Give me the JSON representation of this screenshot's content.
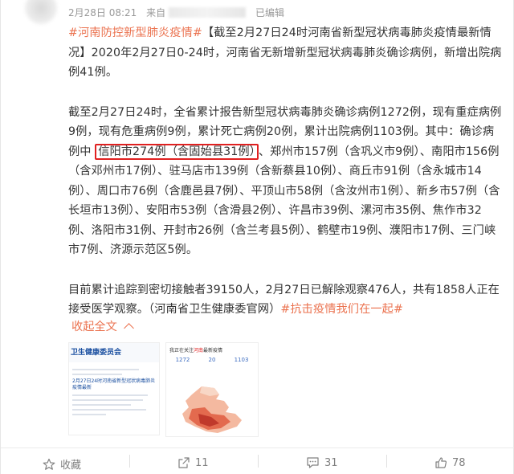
{
  "post": {
    "date": "2月28日 08:21",
    "source_prefix": "来自",
    "edited": "已编辑",
    "hashtag_main": "#河南防控新型肺炎疫情#",
    "para1_rest": "【截至2月27日24时河南省新型冠状病毒肺炎疫情最新情况】2020年2月27日0-24时，河南省无新增新型冠状病毒肺炎确诊病例，新增出院病例41例。",
    "para2_a": "截至2月27日24时，全省累计报告新型冠状病毒肺炎确诊病例1272例，现有重症病例9例，现有危重病例9例，累计死亡病例20例，累计出院病例1103例。其中：确诊病例中 ",
    "para2_highlight": "信阳市274例（含固始县31例）",
    "para2_b": "、郑州市157例（含巩义市9例）、南阳市156例（含邓州市17例）、驻马店市139例（含新蔡县10例）、商丘市91例（含永城市14例）、周口市76例（含鹿邑县7例）、平顶山市58例（含汝州市1例）、新乡市57例（含长垣市13例）、安阳市53例（含滑县2例）、许昌市39例、漯河市35例、焦作市32例、洛阳市31例、开封市26例（含兰考县5例）、鹤壁市19例、濮阳市17例、三门峡市7例、济源示范区5例。",
    "para3_a": "目前累计追踪到密切接触者39150人，2月27日已解除观察476人，共有1858人正在接受医学观察。（河南省卫生健康委官网）",
    "hashtag_end": "#抗击疫情我们在一起#",
    "collapse_label": "收起全文"
  },
  "images": {
    "img1": {
      "logo_text": "卫生健康委员会",
      "headline": "2月27日24时河南省新型冠状病毒肺炎疫情最新"
    },
    "img2": {
      "title_prefix": "我正在关注",
      "title_region": "河南",
      "title_suffix": "最新疫情",
      "stat1": "1272",
      "stat2": "20",
      "stat3": "1103"
    }
  },
  "actions": {
    "favorite_label": "收藏",
    "repost_count": "11",
    "comment_count": "31",
    "like_count": "78"
  },
  "colors": {
    "accent": "#eb7350",
    "highlight_box": "#e02020",
    "muted": "#999999"
  }
}
